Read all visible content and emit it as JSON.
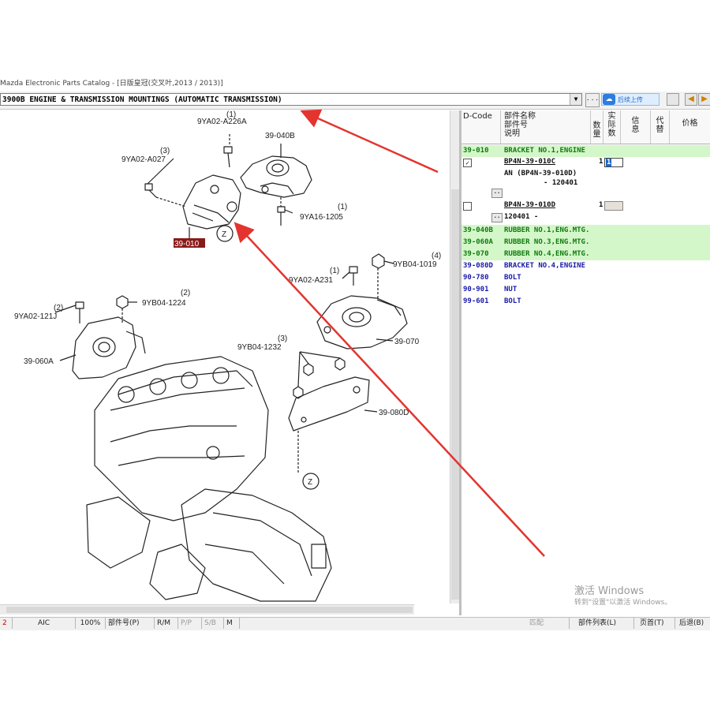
{
  "window": {
    "title": "Mazda Electronic Parts Catalog - [日版皇冠(交叉叶,2013 / 2013)]"
  },
  "toolbar": {
    "section_title": "3900B  ENGINE & TRANSMISSION MOUNTINGS (AUTOMATIC TRANSMISSION)",
    "ellipsis_label": ". . .",
    "cloud_label": "后续上传"
  },
  "diagram": {
    "labels": {
      "p_9ya02_a226a": "9YA02-A226A",
      "q_1a": "(1)",
      "p_39_040b": "39-040B",
      "q_3a": "(3)",
      "p_9ya02_a027": "9YA02-A027",
      "q_1b": "(1)",
      "p_9ya16_1205": "9YA16-1205",
      "p_39_010": "39-010",
      "z1": "Z",
      "q_1c": "(1)",
      "p_9ya02_a231": "9YA02-A231",
      "p_9yb04_1019": "9YB04-1019",
      "q_4": "(4)",
      "q_2a": "(2)",
      "p_9yb04_1224": "9YB04-1224",
      "q_2b": "(2)",
      "p_9ya02_121j": "9YA02-121J",
      "p_39_060a": "39-060A",
      "p_39_070": "39-070",
      "q_3b": "(3)",
      "p_9yb04_1232": "9YB04-1232",
      "p_39_080d": "39-080D",
      "z2": "Z"
    }
  },
  "parts_list": {
    "headers": {
      "dcode": "D-Code",
      "name1": "部件名称",
      "name2": "部件号",
      "name3": "说明",
      "qty1": "数",
      "qty2": "量",
      "actual1": "实",
      "actual2": "际",
      "actual3": "数",
      "info1": "信",
      "info2": "息",
      "sub1": "代",
      "sub2": "替",
      "price": "价格"
    },
    "rows": [
      {
        "code": "39-010",
        "name": "BRACKET NO.1,ENGINE"
      },
      {
        "code": "39-040B",
        "name": "RUBBER NO.1,ENG.MTG."
      },
      {
        "code": "39-060A",
        "name": "RUBBER NO.3,ENG.MTG."
      },
      {
        "code": "39-070",
        "name": "RUBBER NO.4,ENG.MTG."
      },
      {
        "code": "39-080D",
        "name": "BRACKET NO.4,ENGINE"
      },
      {
        "code": "90-780",
        "name": "BOLT"
      },
      {
        "code": "90-901",
        "name": "NUT"
      },
      {
        "code": "99-601",
        "name": "BOLT"
      }
    ],
    "detail1": {
      "checkbox": "✓",
      "part_no": "BP4N-39-010C",
      "qty": "1",
      "qty_input": "1",
      "note1": "AN (BP4N-39-010D)",
      "note2": "- 120401",
      "more": ".."
    },
    "detail2": {
      "part_no": "BP4N-39-010D",
      "qty": "1",
      "note": "120401  -",
      "more": ".."
    }
  },
  "watermark": {
    "line1": "激活 Windows",
    "line2": "转到\"设置\"以激活 Windows。"
  },
  "statusbar": {
    "s1": "2",
    "s2": "AIC",
    "s3": "100%",
    "s4": "部件号(P)",
    "s5": "R/M",
    "s6": "P/P",
    "s7": "S/B",
    "s8": "M",
    "s9": "匹配",
    "s10": "部件列表(L)",
    "s11": "页首(T)",
    "s12": "后退(B)"
  }
}
